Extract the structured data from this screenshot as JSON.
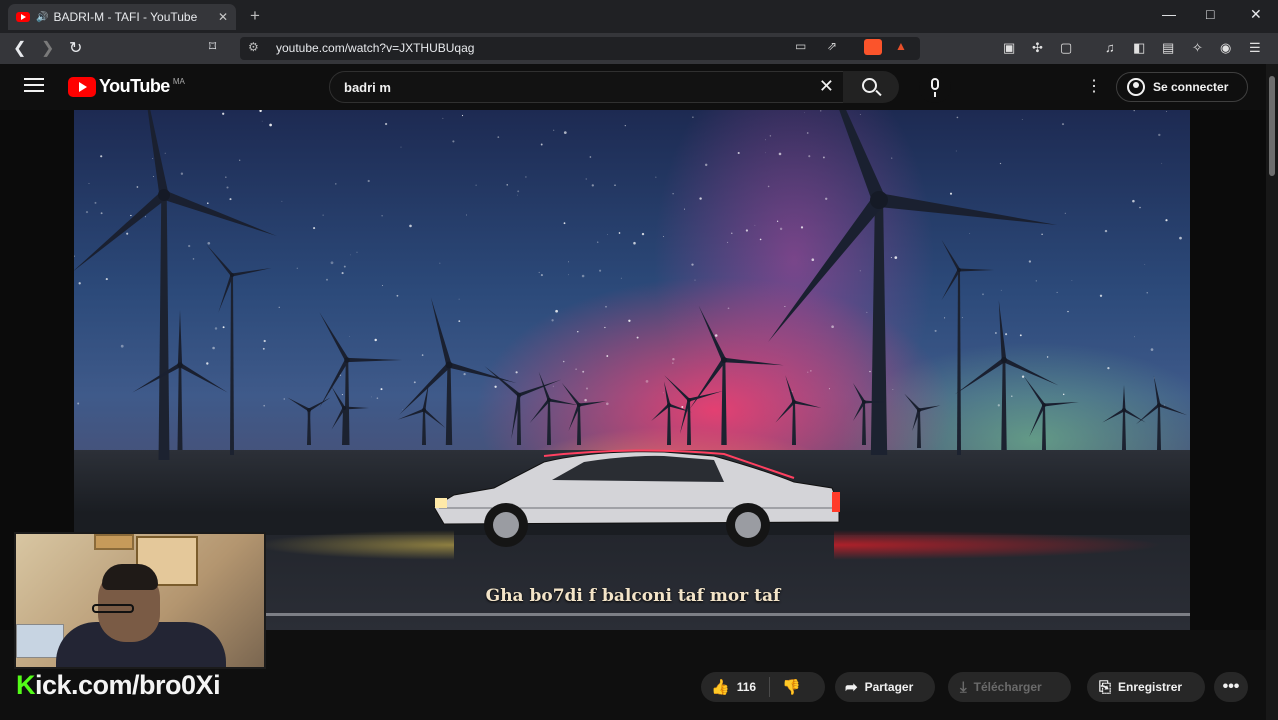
{
  "browser": {
    "tab_title": "BADRI-M - TAFI - YouTube",
    "tab_audio_icon": "speaker-icon",
    "new_tab_label": "+",
    "url": "youtube.com/watch?v=JXTHUBUqag",
    "window_minimize": "—",
    "window_maximize": "□",
    "window_close": "✕"
  },
  "youtube": {
    "logo_text": "YouTube",
    "country_code": "MA",
    "search_value": "badri m",
    "clear_label": "✕",
    "more_label": "⋮",
    "signin_label": "Se connecter"
  },
  "video": {
    "subtitle": "Gha bo7di f balconi taf mor taf"
  },
  "stream": {
    "kick_k": "K",
    "kick_rest": "ick.com/bro0Xi"
  },
  "actions": {
    "like_count": "116",
    "share_label": "Partager",
    "download_label": "Télécharger",
    "save_label": "Enregistrer",
    "more_label": "•••"
  },
  "colors": {
    "youtube_red": "#ff0000",
    "kick_green": "#53fc18",
    "background": "#0f0f0f",
    "pill": "#272727"
  }
}
